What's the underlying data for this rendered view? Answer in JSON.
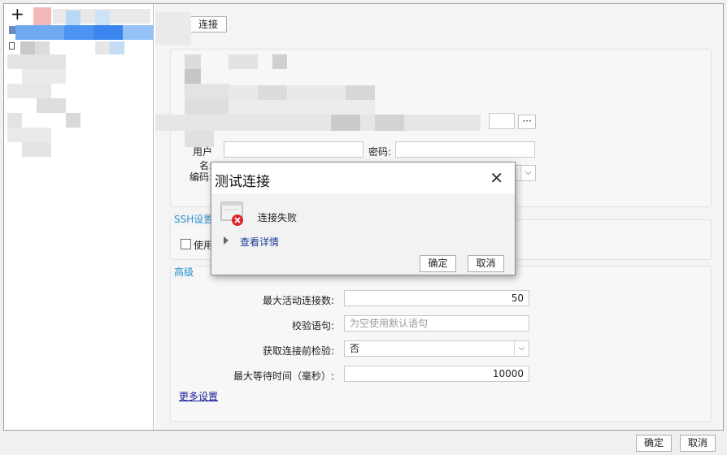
{
  "toolbar": {
    "add_label": "+"
  },
  "main": {
    "test_button_label": "连接",
    "username_label": "用户名:",
    "password_label": "密码:",
    "encoding_label": "编码:",
    "ellipsis_label": "···",
    "ssh": {
      "title": "SSH设置",
      "use_label": "使用"
    },
    "advanced": {
      "title": "高级",
      "max_active_label": "最大活动连接数:",
      "max_active_value": "50",
      "validation_query_label": "校验语句:",
      "validation_query_placeholder": "为空使用默认语句",
      "test_on_borrow_label": "获取连接前检验:",
      "test_on_borrow_value": "否",
      "max_wait_label": "最大等待时间（毫秒）:",
      "max_wait_value": "10000"
    },
    "more_settings_label": "更多设置"
  },
  "footer": {
    "ok_label": "确定",
    "cancel_label": "取消"
  },
  "dialog": {
    "title": "测试连接",
    "message": "连接失败",
    "details_label": "查看详情",
    "ok_label": "确定",
    "cancel_label": "取消"
  }
}
